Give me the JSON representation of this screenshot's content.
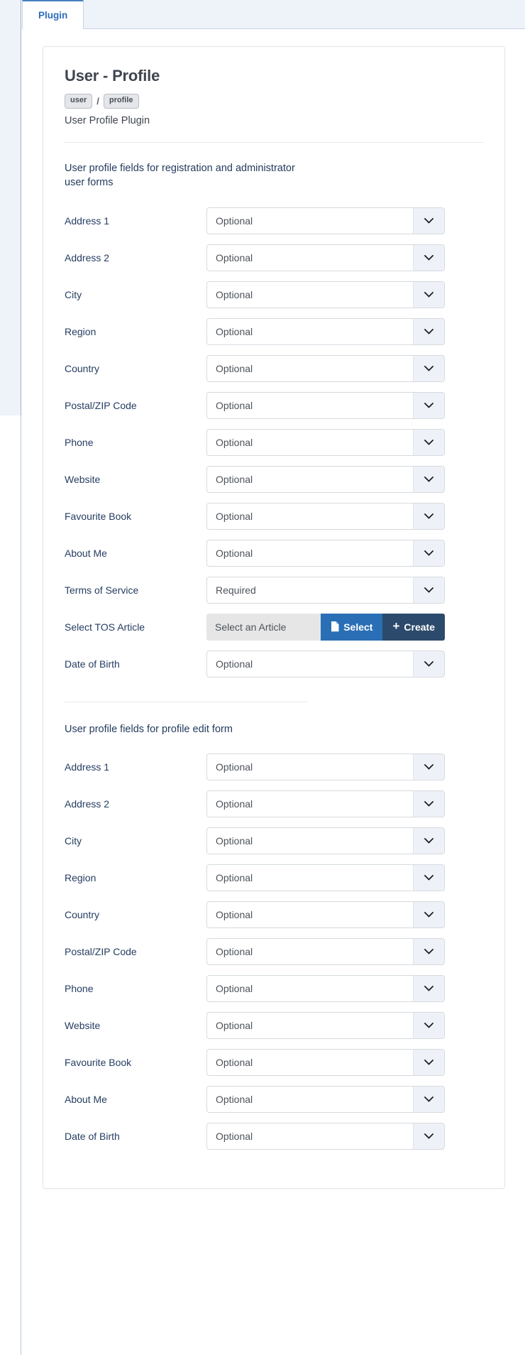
{
  "tabs": [
    {
      "label": "Plugin",
      "active": true
    }
  ],
  "header": {
    "title": "User - Profile",
    "badges": [
      "user",
      "profile"
    ],
    "badge_separator": "/",
    "description": "User Profile Plugin"
  },
  "colors": {
    "accent_blue": "#2a6fb5",
    "dark_navy": "#2c4a6b",
    "label_text": "#253d61",
    "tab_active": "#2b6cb9",
    "tab_bar_bg": "#eef2f9",
    "select_arrow_bg": "#eef2f8",
    "article_field_bg": "#e6e6e6"
  },
  "sections": [
    {
      "heading": "User profile fields for registration and administrator user forms",
      "fields": [
        {
          "label": "Address 1",
          "control": "select",
          "value": "Optional"
        },
        {
          "label": "Address 2",
          "control": "select",
          "value": "Optional"
        },
        {
          "label": "City",
          "control": "select",
          "value": "Optional"
        },
        {
          "label": "Region",
          "control": "select",
          "value": "Optional"
        },
        {
          "label": "Country",
          "control": "select",
          "value": "Optional"
        },
        {
          "label": "Postal/ZIP Code",
          "control": "select",
          "value": "Optional"
        },
        {
          "label": "Phone",
          "control": "select",
          "value": "Optional"
        },
        {
          "label": "Website",
          "control": "select",
          "value": "Optional"
        },
        {
          "label": "Favourite Book",
          "control": "select",
          "value": "Optional"
        },
        {
          "label": "About Me",
          "control": "select",
          "value": "Optional"
        },
        {
          "label": "Terms of Service",
          "control": "select",
          "value": "Required"
        },
        {
          "label": "Select TOS Article",
          "control": "article-picker",
          "value": "Select an Article",
          "select_button": "Select",
          "create_button": "Create",
          "create_prefix": "+"
        },
        {
          "label": "Date of Birth",
          "control": "select",
          "value": "Optional"
        }
      ]
    },
    {
      "heading": "User profile fields for profile edit form",
      "fields": [
        {
          "label": "Address 1",
          "control": "select",
          "value": "Optional"
        },
        {
          "label": "Address 2",
          "control": "select",
          "value": "Optional"
        },
        {
          "label": "City",
          "control": "select",
          "value": "Optional"
        },
        {
          "label": "Region",
          "control": "select",
          "value": "Optional"
        },
        {
          "label": "Country",
          "control": "select",
          "value": "Optional"
        },
        {
          "label": "Postal/ZIP Code",
          "control": "select",
          "value": "Optional"
        },
        {
          "label": "Phone",
          "control": "select",
          "value": "Optional"
        },
        {
          "label": "Website",
          "control": "select",
          "value": "Optional"
        },
        {
          "label": "Favourite Book",
          "control": "select",
          "value": "Optional"
        },
        {
          "label": "About Me",
          "control": "select",
          "value": "Optional"
        },
        {
          "label": "Date of Birth",
          "control": "select",
          "value": "Optional"
        }
      ]
    }
  ]
}
